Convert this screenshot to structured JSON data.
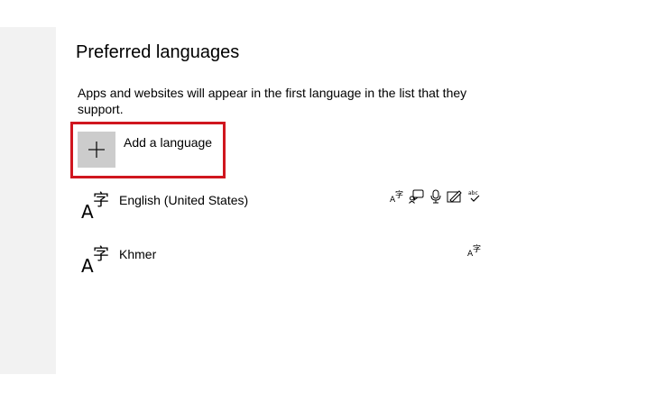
{
  "header": {
    "title": "Preferred languages"
  },
  "description": "Apps and websites will appear in the first language in the list that they support.",
  "add_language": {
    "label": "Add a language",
    "icon": "plus-icon"
  },
  "languages": [
    {
      "name": "English (United States)",
      "icon": "language-icon",
      "features": [
        "display-language-icon",
        "text-to-speech-icon",
        "speech-recognition-icon",
        "handwriting-icon",
        "spell-check-icon"
      ]
    },
    {
      "name": "Khmer",
      "icon": "language-icon",
      "features": [
        "display-language-icon"
      ]
    }
  ],
  "colors": {
    "highlight_border": "#d0161f",
    "tile_bg": "#cccccc",
    "left_pane_bg": "#f2f2f2"
  }
}
